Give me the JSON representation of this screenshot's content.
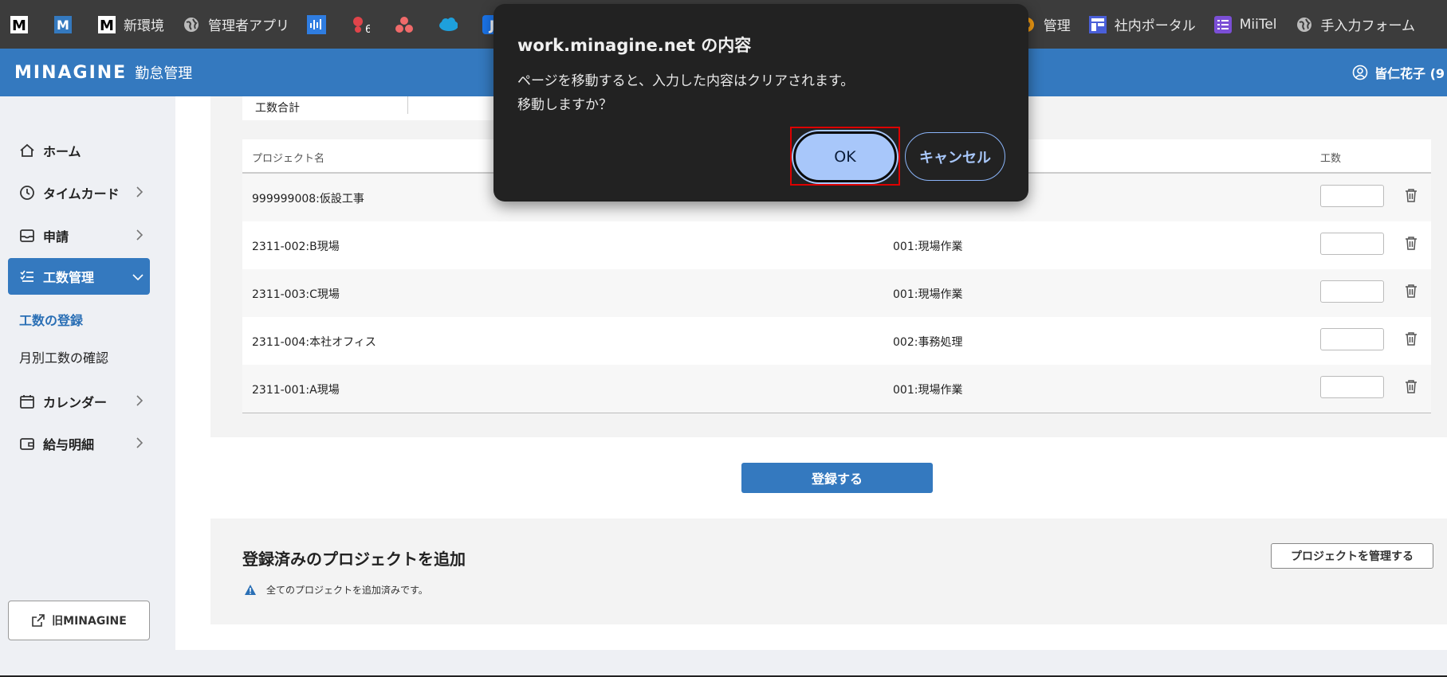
{
  "bookmarks": {
    "items": [
      {
        "label": "",
        "icon": "m-logo-icon"
      },
      {
        "label": "",
        "icon": "m-blue-logo-icon"
      },
      {
        "label": "新環境",
        "icon": "m-logo-icon"
      },
      {
        "label": "管理者アプリ",
        "icon": "globe-icon"
      },
      {
        "label": "",
        "icon": "audio-bars-icon"
      },
      {
        "label": "",
        "icon": "notification-6-icon"
      },
      {
        "label": "",
        "icon": "asana-icon"
      },
      {
        "label": "",
        "icon": "salesforce-cloud-icon"
      },
      {
        "label": "",
        "icon": "j-app-icon"
      }
    ],
    "right_items": [
      {
        "label": "管理",
        "icon": "app-icon"
      },
      {
        "label": "社内ポータル",
        "icon": "portal-icon"
      },
      {
        "label": "MiiTel",
        "icon": "list-icon"
      },
      {
        "label": "手入力フォーム",
        "icon": "globe-icon"
      }
    ]
  },
  "header": {
    "logo": "MINAGINE",
    "app_name": "勤怠管理",
    "user": "皆仁花子 (9"
  },
  "sidebar": {
    "items": [
      {
        "label": "ホーム"
      },
      {
        "label": "タイムカード"
      },
      {
        "label": "申請"
      },
      {
        "label": "工数管理"
      },
      {
        "label": "カレンダー"
      },
      {
        "label": "給与明細"
      }
    ],
    "sub_items": [
      {
        "label": "工数の登録"
      },
      {
        "label": "月別工数の確認"
      }
    ],
    "old_button": "旧MINAGINE"
  },
  "main": {
    "total_label": "工数合計",
    "columns": {
      "project": "プロジェクト名",
      "hours": "工数"
    },
    "rows": [
      {
        "project": "999999008:仮設工事",
        "work": "",
        "hours": ""
      },
      {
        "project": "2311-002:B現場",
        "work": "001:現場作業",
        "hours": ""
      },
      {
        "project": "2311-003:C現場",
        "work": "001:現場作業",
        "hours": ""
      },
      {
        "project": "2311-004:本社オフィス",
        "work": "002:事務処理",
        "hours": ""
      },
      {
        "project": "2311-001:A現場",
        "work": "001:現場作業",
        "hours": ""
      }
    ],
    "register_button": "登録する",
    "add_section": {
      "title": "登録済みのプロジェクトを追加",
      "manage_button": "プロジェクトを管理する",
      "notice": "全てのプロジェクトを追加済みです。"
    }
  },
  "dialog": {
    "title": "work.minagine.net の内容",
    "line1": "ページを移動すると、入力した内容はクリアされます。",
    "line2": "移動しますか？",
    "ok": "OK",
    "cancel": "キャンセル"
  },
  "colors": {
    "brand": "#3479bf",
    "dialog_bg": "#222222",
    "ok_bg": "#a8c7fa"
  }
}
